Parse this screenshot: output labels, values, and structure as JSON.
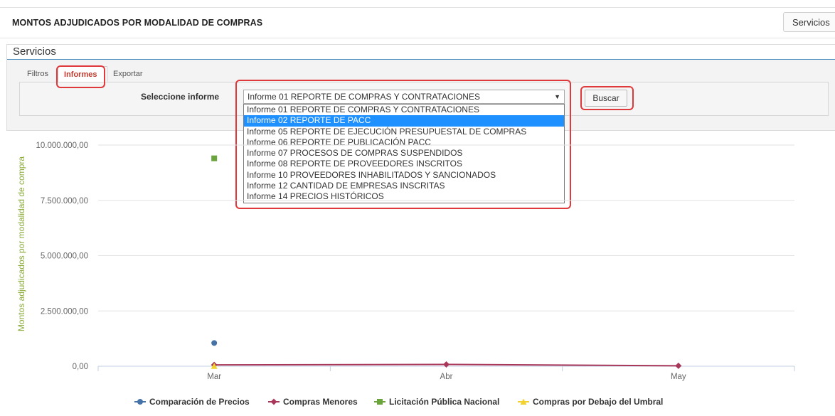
{
  "header": {
    "title": "MONTOS ADJUDICADOS POR MODALIDAD DE COMPRAS",
    "servicios_button": "Servicios"
  },
  "panel": {
    "title": "Servicios",
    "tabs": [
      {
        "label": "Filtros",
        "active": false
      },
      {
        "label": "Informes",
        "active": true
      },
      {
        "label": "Exportar",
        "active": false
      }
    ],
    "select_label": "Seleccione informe",
    "select_value": "Informe 01 REPORTE DE COMPRAS Y CONTRATACIONES",
    "options": [
      "Informe 01 REPORTE DE COMPRAS Y CONTRATACIONES",
      "Informe 02 REPORTE DE PACC",
      "Informe 05 REPORTE DE EJECUCIÓN PRESUPUESTAL DE COMPRAS",
      "Informe 06 REPORTE DE PUBLICACIÓN PACC",
      "Informe 07 PROCESOS DE COMPRAS SUSPENDIDOS",
      "Informe 08 REPORTE DE PROVEEDORES INSCRITOS",
      "Informe 10 PROVEEDORES INHABILITADOS Y SANCIONADOS",
      "Informe 12 CANTIDAD DE EMPRESAS INSCRITAS",
      "Informe 14 PRECIOS HISTÓRICOS"
    ],
    "highlighted_option": "Informe 02 REPORTE DE PACC",
    "buscar_button": "Buscar"
  },
  "colors": {
    "accent_red": "#e0393b",
    "tab_active_text": "#c0392b",
    "option_highlight": "#1e90ff",
    "series_comparacion": "#4572a7",
    "series_menores": "#a8375a",
    "series_licitacion": "#6ba33c",
    "series_umbral": "#f2d230",
    "ylabel_color": "#8bab3a"
  },
  "chart_data": {
    "type": "line",
    "categories": [
      "Mar",
      "Abr",
      "May"
    ],
    "ylabel": "Montos adjudicados por modalidad de compra",
    "ylim": [
      0,
      10000000
    ],
    "yticks": [
      "0,00",
      "2.500.000,00",
      "5.000.000,00",
      "7.500.000,00",
      "10.000.000,00"
    ],
    "yticks_values": [
      0,
      2500000,
      5000000,
      7500000,
      10000000
    ],
    "grid": true,
    "legend_position": "bottom",
    "series": [
      {
        "name": "Comparación de Precios",
        "values": [
          1050000,
          null,
          null
        ],
        "marker": "circle",
        "color_key": "series_comparacion"
      },
      {
        "name": "Compras Menores",
        "values": [
          60000,
          80000,
          20000
        ],
        "marker": "diamond",
        "color_key": "series_menores"
      },
      {
        "name": "Licitación Pública Nacional",
        "values": [
          9400000,
          null,
          null
        ],
        "marker": "square",
        "color_key": "series_licitacion"
      },
      {
        "name": "Compras por Debajo del Umbral",
        "values": [
          10000,
          null,
          null
        ],
        "marker": "triangle",
        "color_key": "series_umbral"
      }
    ]
  }
}
